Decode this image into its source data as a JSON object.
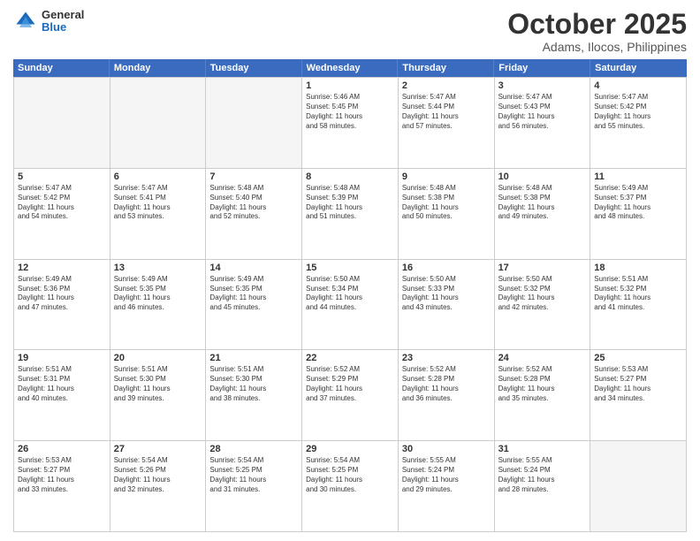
{
  "header": {
    "logo_general": "General",
    "logo_blue": "Blue",
    "month": "October 2025",
    "location": "Adams, Ilocos, Philippines"
  },
  "weekdays": [
    "Sunday",
    "Monday",
    "Tuesday",
    "Wednesday",
    "Thursday",
    "Friday",
    "Saturday"
  ],
  "weeks": [
    [
      {
        "day": "",
        "info": ""
      },
      {
        "day": "",
        "info": ""
      },
      {
        "day": "",
        "info": ""
      },
      {
        "day": "1",
        "info": "Sunrise: 5:46 AM\nSunset: 5:45 PM\nDaylight: 11 hours\nand 58 minutes."
      },
      {
        "day": "2",
        "info": "Sunrise: 5:47 AM\nSunset: 5:44 PM\nDaylight: 11 hours\nand 57 minutes."
      },
      {
        "day": "3",
        "info": "Sunrise: 5:47 AM\nSunset: 5:43 PM\nDaylight: 11 hours\nand 56 minutes."
      },
      {
        "day": "4",
        "info": "Sunrise: 5:47 AM\nSunset: 5:42 PM\nDaylight: 11 hours\nand 55 minutes."
      }
    ],
    [
      {
        "day": "5",
        "info": "Sunrise: 5:47 AM\nSunset: 5:42 PM\nDaylight: 11 hours\nand 54 minutes."
      },
      {
        "day": "6",
        "info": "Sunrise: 5:47 AM\nSunset: 5:41 PM\nDaylight: 11 hours\nand 53 minutes."
      },
      {
        "day": "7",
        "info": "Sunrise: 5:48 AM\nSunset: 5:40 PM\nDaylight: 11 hours\nand 52 minutes."
      },
      {
        "day": "8",
        "info": "Sunrise: 5:48 AM\nSunset: 5:39 PM\nDaylight: 11 hours\nand 51 minutes."
      },
      {
        "day": "9",
        "info": "Sunrise: 5:48 AM\nSunset: 5:38 PM\nDaylight: 11 hours\nand 50 minutes."
      },
      {
        "day": "10",
        "info": "Sunrise: 5:48 AM\nSunset: 5:38 PM\nDaylight: 11 hours\nand 49 minutes."
      },
      {
        "day": "11",
        "info": "Sunrise: 5:49 AM\nSunset: 5:37 PM\nDaylight: 11 hours\nand 48 minutes."
      }
    ],
    [
      {
        "day": "12",
        "info": "Sunrise: 5:49 AM\nSunset: 5:36 PM\nDaylight: 11 hours\nand 47 minutes."
      },
      {
        "day": "13",
        "info": "Sunrise: 5:49 AM\nSunset: 5:35 PM\nDaylight: 11 hours\nand 46 minutes."
      },
      {
        "day": "14",
        "info": "Sunrise: 5:49 AM\nSunset: 5:35 PM\nDaylight: 11 hours\nand 45 minutes."
      },
      {
        "day": "15",
        "info": "Sunrise: 5:50 AM\nSunset: 5:34 PM\nDaylight: 11 hours\nand 44 minutes."
      },
      {
        "day": "16",
        "info": "Sunrise: 5:50 AM\nSunset: 5:33 PM\nDaylight: 11 hours\nand 43 minutes."
      },
      {
        "day": "17",
        "info": "Sunrise: 5:50 AM\nSunset: 5:32 PM\nDaylight: 11 hours\nand 42 minutes."
      },
      {
        "day": "18",
        "info": "Sunrise: 5:51 AM\nSunset: 5:32 PM\nDaylight: 11 hours\nand 41 minutes."
      }
    ],
    [
      {
        "day": "19",
        "info": "Sunrise: 5:51 AM\nSunset: 5:31 PM\nDaylight: 11 hours\nand 40 minutes."
      },
      {
        "day": "20",
        "info": "Sunrise: 5:51 AM\nSunset: 5:30 PM\nDaylight: 11 hours\nand 39 minutes."
      },
      {
        "day": "21",
        "info": "Sunrise: 5:51 AM\nSunset: 5:30 PM\nDaylight: 11 hours\nand 38 minutes."
      },
      {
        "day": "22",
        "info": "Sunrise: 5:52 AM\nSunset: 5:29 PM\nDaylight: 11 hours\nand 37 minutes."
      },
      {
        "day": "23",
        "info": "Sunrise: 5:52 AM\nSunset: 5:28 PM\nDaylight: 11 hours\nand 36 minutes."
      },
      {
        "day": "24",
        "info": "Sunrise: 5:52 AM\nSunset: 5:28 PM\nDaylight: 11 hours\nand 35 minutes."
      },
      {
        "day": "25",
        "info": "Sunrise: 5:53 AM\nSunset: 5:27 PM\nDaylight: 11 hours\nand 34 minutes."
      }
    ],
    [
      {
        "day": "26",
        "info": "Sunrise: 5:53 AM\nSunset: 5:27 PM\nDaylight: 11 hours\nand 33 minutes."
      },
      {
        "day": "27",
        "info": "Sunrise: 5:54 AM\nSunset: 5:26 PM\nDaylight: 11 hours\nand 32 minutes."
      },
      {
        "day": "28",
        "info": "Sunrise: 5:54 AM\nSunset: 5:25 PM\nDaylight: 11 hours\nand 31 minutes."
      },
      {
        "day": "29",
        "info": "Sunrise: 5:54 AM\nSunset: 5:25 PM\nDaylight: 11 hours\nand 30 minutes."
      },
      {
        "day": "30",
        "info": "Sunrise: 5:55 AM\nSunset: 5:24 PM\nDaylight: 11 hours\nand 29 minutes."
      },
      {
        "day": "31",
        "info": "Sunrise: 5:55 AM\nSunset: 5:24 PM\nDaylight: 11 hours\nand 28 minutes."
      },
      {
        "day": "",
        "info": ""
      }
    ]
  ]
}
